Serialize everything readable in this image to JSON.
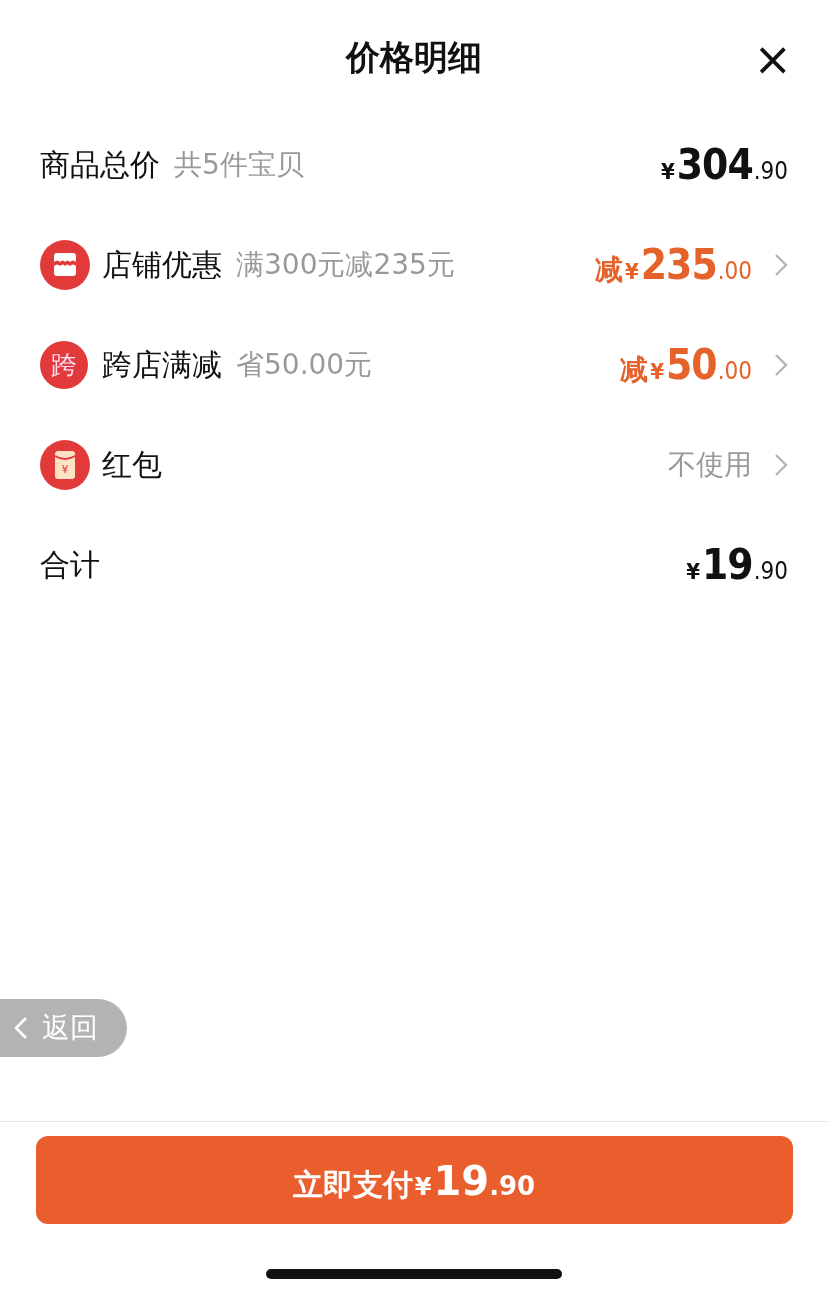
{
  "header": {
    "title": "价格明细",
    "close": "×"
  },
  "rows": [
    {
      "kind": "plain",
      "label": "商品总价",
      "note": "共5件宝贝",
      "amount": {
        "kind": "normal",
        "currency": "¥",
        "integer": "304",
        "decimals": ".90"
      },
      "chevron": false
    },
    {
      "kind": "shop",
      "label": "店铺优惠",
      "note": "满300元减235元",
      "amount": {
        "kind": "discount",
        "prefix": "减",
        "currency": "¥",
        "integer": "235",
        "decimals": ".00"
      },
      "chevron": true
    },
    {
      "kind": "badge",
      "badge": "跨",
      "label": "跨店满减",
      "note": "省50.00元",
      "amount": {
        "kind": "discount",
        "prefix": "减",
        "currency": "¥",
        "integer": "50",
        "decimals": ".00"
      },
      "chevron": true
    },
    {
      "kind": "packet",
      "packet_sign": "¥",
      "label": "红包",
      "value": "不使用",
      "chevron": true
    },
    {
      "kind": "plain",
      "label": "合计",
      "amount": {
        "kind": "normal",
        "currency": "¥",
        "integer": "19",
        "decimals": ".90"
      },
      "chevron": false
    }
  ],
  "back_button": {
    "label": "返回"
  },
  "pay_button": {
    "label": "立即支付",
    "currency": "¥",
    "integer": "19",
    "decimals": ".90"
  }
}
